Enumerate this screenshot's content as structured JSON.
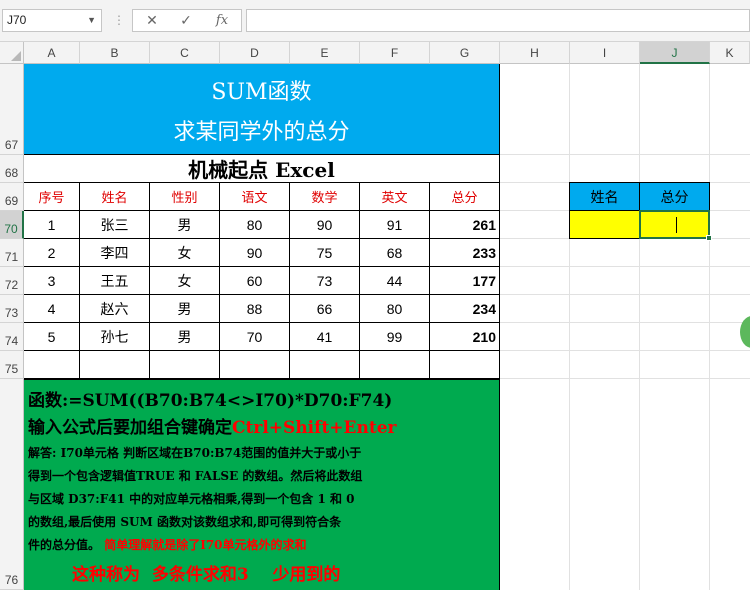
{
  "formula_bar": {
    "name_box": "J70",
    "cancel_icon": "✕",
    "enter_icon": "✓",
    "fx_label": "fx",
    "formula": ""
  },
  "columns": [
    "A",
    "B",
    "C",
    "D",
    "E",
    "F",
    "G",
    "H",
    "I",
    "J",
    "K"
  ],
  "rows": [
    "67",
    "68",
    "69",
    "70",
    "71",
    "72",
    "73",
    "74",
    "75",
    "76"
  ],
  "title": {
    "line1": "SUM函数",
    "line2": "求某同学外的总分"
  },
  "subtitle": "机械起点 Excel",
  "table": {
    "headers": [
      "序号",
      "姓名",
      "性别",
      "语文",
      "数学",
      "英文",
      "总分"
    ],
    "rows": [
      [
        "1",
        "张三",
        "男",
        "80",
        "90",
        "91",
        "261"
      ],
      [
        "2",
        "李四",
        "女",
        "90",
        "75",
        "68",
        "233"
      ],
      [
        "3",
        "王五",
        "女",
        "60",
        "73",
        "44",
        "177"
      ],
      [
        "4",
        "赵六",
        "男",
        "88",
        "66",
        "80",
        "234"
      ],
      [
        "5",
        "孙七",
        "男",
        "70",
        "41",
        "99",
        "210"
      ]
    ]
  },
  "lookup": {
    "header_name": "姓名",
    "header_total": "总分",
    "name_value": "",
    "total_value": ""
  },
  "explain": {
    "formula_line": "函数:=SUM((B70:B74<>I70)*D70:F74)",
    "line2_black": "输入公式后要加组合键确定",
    "line2_red": "Ctrl+Shift+Enter",
    "para1": "解答: I70单元格  判断区域在B70:B74范围的值并大于或小于",
    "para2": "得到一个包含逻辑值TRUE 和 FALSE 的数组。然后将此数组",
    "para3": "与区域 D37:F41 中的对应单元格相乘,得到一个包含 1 和 0",
    "para4": "的数组,最后使用 SUM 函数对该数组求和,即可得到符合条",
    "para5_black": "件的总分值。",
    "para5_red": "简单理解就是除了I70单元格外的求和",
    "footer": "这种称为  多条件求和3    少用到的"
  },
  "colors": {
    "title_bg": "#00aaee",
    "explain_bg": "#00aa4f",
    "lookup_header_bg": "#00aaee",
    "lookup_input_bg": "#ffff00",
    "accent_red": "#ff0000",
    "excel_green": "#217346"
  }
}
